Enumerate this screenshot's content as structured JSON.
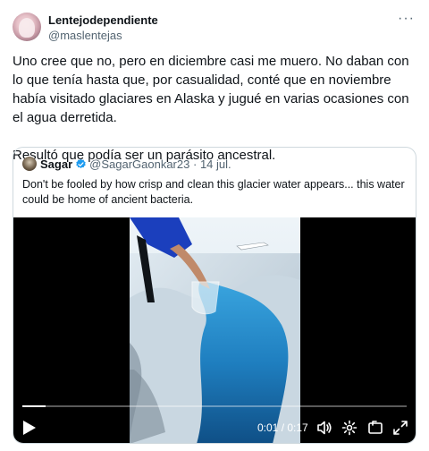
{
  "author": {
    "display_name": "Lentejodependiente",
    "handle": "@maslentejas"
  },
  "menu": {
    "more_icon": "more-horizontal-icon",
    "more_glyph": "···"
  },
  "tweet_text": "Uno cree que no, pero en diciembre casi me muero. No daban con lo que tenía hasta que, por casualidad, conté que en noviembre había visitado glaciares en Alaska y jugué en varias ocasiones con el agua derretida.\n\nResultó que podía ser un parásito ancestral.",
  "quote": {
    "display_name": "Sagar",
    "verified": true,
    "handle": "@SagarGaonkar23",
    "separator": "·",
    "date": "14 jul.",
    "text": "Don't be fooled by how crisp and clean this glacier water appears... this water could be home of ancient bacteria.",
    "video": {
      "time_display": "0:01 / 0:17",
      "progress": 0.06
    }
  },
  "colors": {
    "accent_verified": "#1d9bf0",
    "text_primary": "#0f1419",
    "text_secondary": "#536471",
    "border": "#cfd9de"
  }
}
